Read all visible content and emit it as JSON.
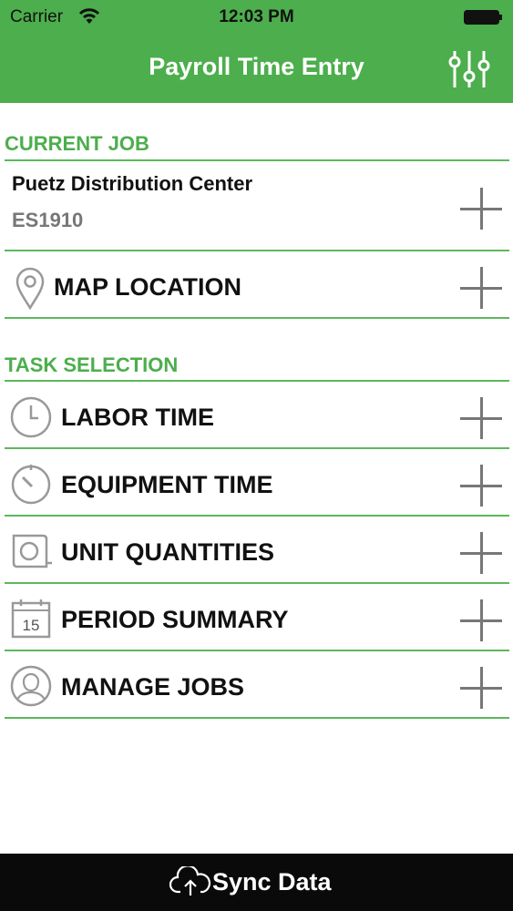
{
  "status_bar": {
    "carrier": "Carrier",
    "time": "12:03 PM"
  },
  "nav": {
    "title": "Payroll Time Entry"
  },
  "current_job": {
    "header": "CURRENT JOB",
    "job_name": "Puetz Distribution Center",
    "job_code": "ES1910",
    "map_location_label": "MAP LOCATION"
  },
  "task_selection": {
    "header": "TASK SELECTION",
    "items": [
      {
        "label": "LABOR TIME",
        "icon": "clock-icon"
      },
      {
        "label": "EQUIPMENT TIME",
        "icon": "stopwatch-icon"
      },
      {
        "label": "UNIT QUANTITIES",
        "icon": "tape-measure-icon"
      },
      {
        "label": "PERIOD SUMMARY",
        "icon": "calendar-icon",
        "icon_text": "15"
      },
      {
        "label": "MANAGE JOBS",
        "icon": "person-icon"
      }
    ]
  },
  "footer": {
    "sync_label": "Sync Data"
  },
  "colors": {
    "accent": "#4cae4c",
    "footer_bg": "#0a0a0a",
    "plus": "#777777"
  }
}
